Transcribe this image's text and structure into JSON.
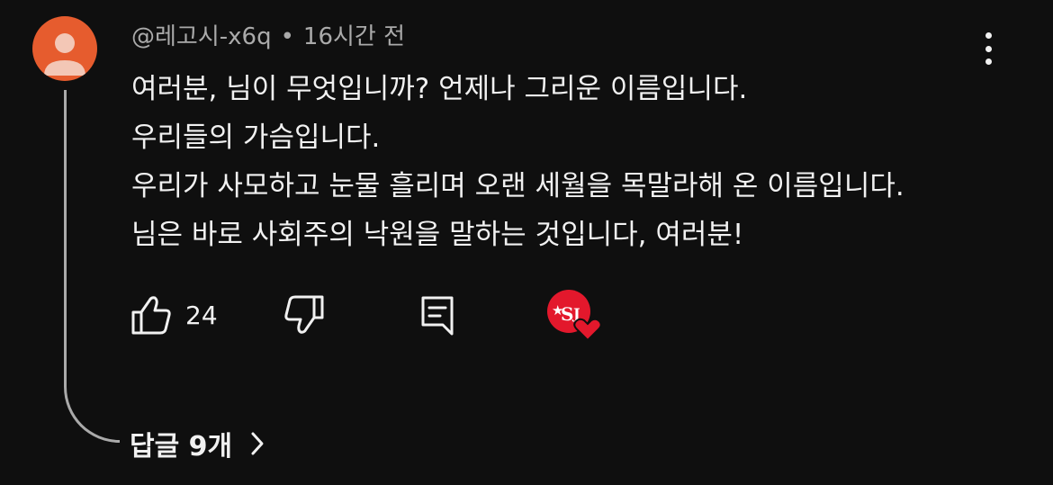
{
  "comment": {
    "author": "@레고시-x6q",
    "separator": "•",
    "time": "16시간 전",
    "lines": [
      "여러분, 님이 무엇입니까? 언제나 그리운 이름입니다.",
      "우리들의 가슴입니다.",
      "우리가 사모하고 눈물 흘리며 오랜 세월을 목말라해 온 이름입니다.",
      "님은 바로 사회주의 낙원을 말하는 것입니다, 여러분!"
    ],
    "like_count": "24",
    "replies_label": "답글 9개"
  },
  "colors": {
    "avatar_bg": "#e65c2e",
    "avatar_fg": "#f3c7b6",
    "background": "#0f0f0f",
    "heart": "#e3182c"
  },
  "icons": [
    "person-avatar",
    "more-vert-icon",
    "thumb-up-icon",
    "thumb-down-icon",
    "reply-icon",
    "creator-heart-badge",
    "chevron-right-icon"
  ]
}
